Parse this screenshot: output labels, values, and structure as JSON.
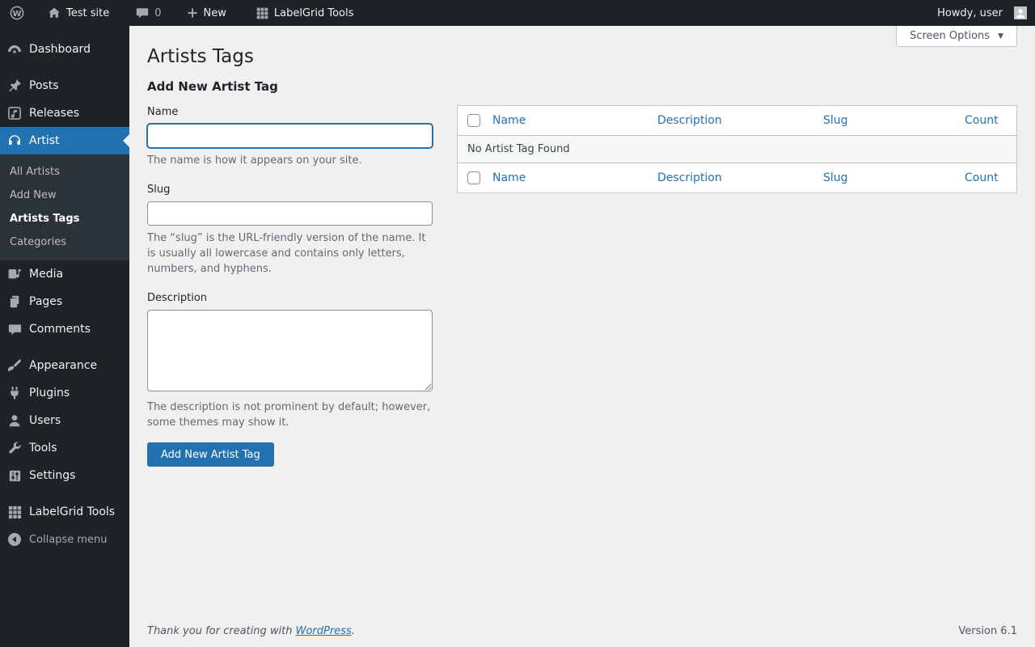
{
  "admin_bar": {
    "site_name": "Test site",
    "comment_count": "0",
    "new_label": "New",
    "labelgrid_label": "LabelGrid Tools",
    "howdy_label": "Howdy, user"
  },
  "sidebar": {
    "items": [
      {
        "label": "Dashboard",
        "icon": "dashboard-gauge-icon"
      },
      {
        "label": "Posts",
        "icon": "pushpin-icon"
      },
      {
        "label": "Releases",
        "icon": "music-note-icon"
      },
      {
        "label": "Artist",
        "icon": "headphones-icon",
        "active": true
      },
      {
        "label": "Media",
        "icon": "media-icon"
      },
      {
        "label": "Pages",
        "icon": "pages-icon"
      },
      {
        "label": "Comments",
        "icon": "comment-bubble-icon"
      },
      {
        "label": "Appearance",
        "icon": "paintbrush-icon"
      },
      {
        "label": "Plugins",
        "icon": "plug-icon"
      },
      {
        "label": "Users",
        "icon": "person-icon"
      },
      {
        "label": "Tools",
        "icon": "wrench-icon"
      },
      {
        "label": "Settings",
        "icon": "sliders-icon"
      },
      {
        "label": "LabelGrid Tools",
        "icon": "grid-icon"
      },
      {
        "label": "Collapse menu",
        "icon": "collapse-arrow-icon"
      }
    ],
    "artist_submenu": {
      "items": [
        "All Artists",
        "Add New",
        "Artists Tags",
        "Categories"
      ],
      "current": "Artists Tags"
    }
  },
  "main": {
    "page_title": "Artists Tags",
    "screen_options_label": "Screen Options",
    "form": {
      "heading": "Add New Artist Tag",
      "name_label": "Name",
      "name_value": "",
      "name_hint": "The name is how it appears on your site.",
      "slug_label": "Slug",
      "slug_value": "",
      "slug_hint": "The “slug” is the URL-friendly version of the name. It is usually all lowercase and contains only letters, numbers, and hyphens.",
      "description_label": "Description",
      "description_value": "",
      "description_hint": "The description is not prominent by default; however, some themes may show it.",
      "submit_label": "Add New Artist Tag"
    },
    "table": {
      "columns": [
        "Name",
        "Description",
        "Slug",
        "Count"
      ],
      "empty_message": "No Artist Tag Found"
    }
  },
  "footer": {
    "thanks_prefix": "Thank you for creating with ",
    "wordpress_link_label": "WordPress",
    "thanks_suffix": ".",
    "version": "Version 6.1"
  },
  "colors": {
    "accent_blue": "#2271b1",
    "admin_bar_bg": "#1d2327",
    "sidebar_bg": "#1d2327",
    "submenu_bg": "#2c3338",
    "content_bg": "#f0f0f1",
    "link_blue": "#2271b1",
    "muted_text": "#646970",
    "table_border": "#c3c4c7",
    "empty_row_bg": "#f6f7f7"
  },
  "icons": {
    "wordpress-logo-icon": "Ⓦ",
    "home-icon": "⌂",
    "comment-bubble-icon": "🗨",
    "plus-icon": "＋",
    "grid-icon": "▦",
    "dashboard-gauge-icon": "◔",
    "pushpin-icon": "📌",
    "music-note-icon": "♪",
    "headphones-icon": "🎧",
    "media-icon": "♫",
    "pages-icon": "❐",
    "paintbrush-icon": "🖌",
    "plug-icon": "🔌",
    "person-icon": "👤",
    "wrench-icon": "🔧",
    "sliders-icon": "🎚",
    "collapse-arrow-icon": "◀",
    "chevron-down-icon": "▼"
  }
}
